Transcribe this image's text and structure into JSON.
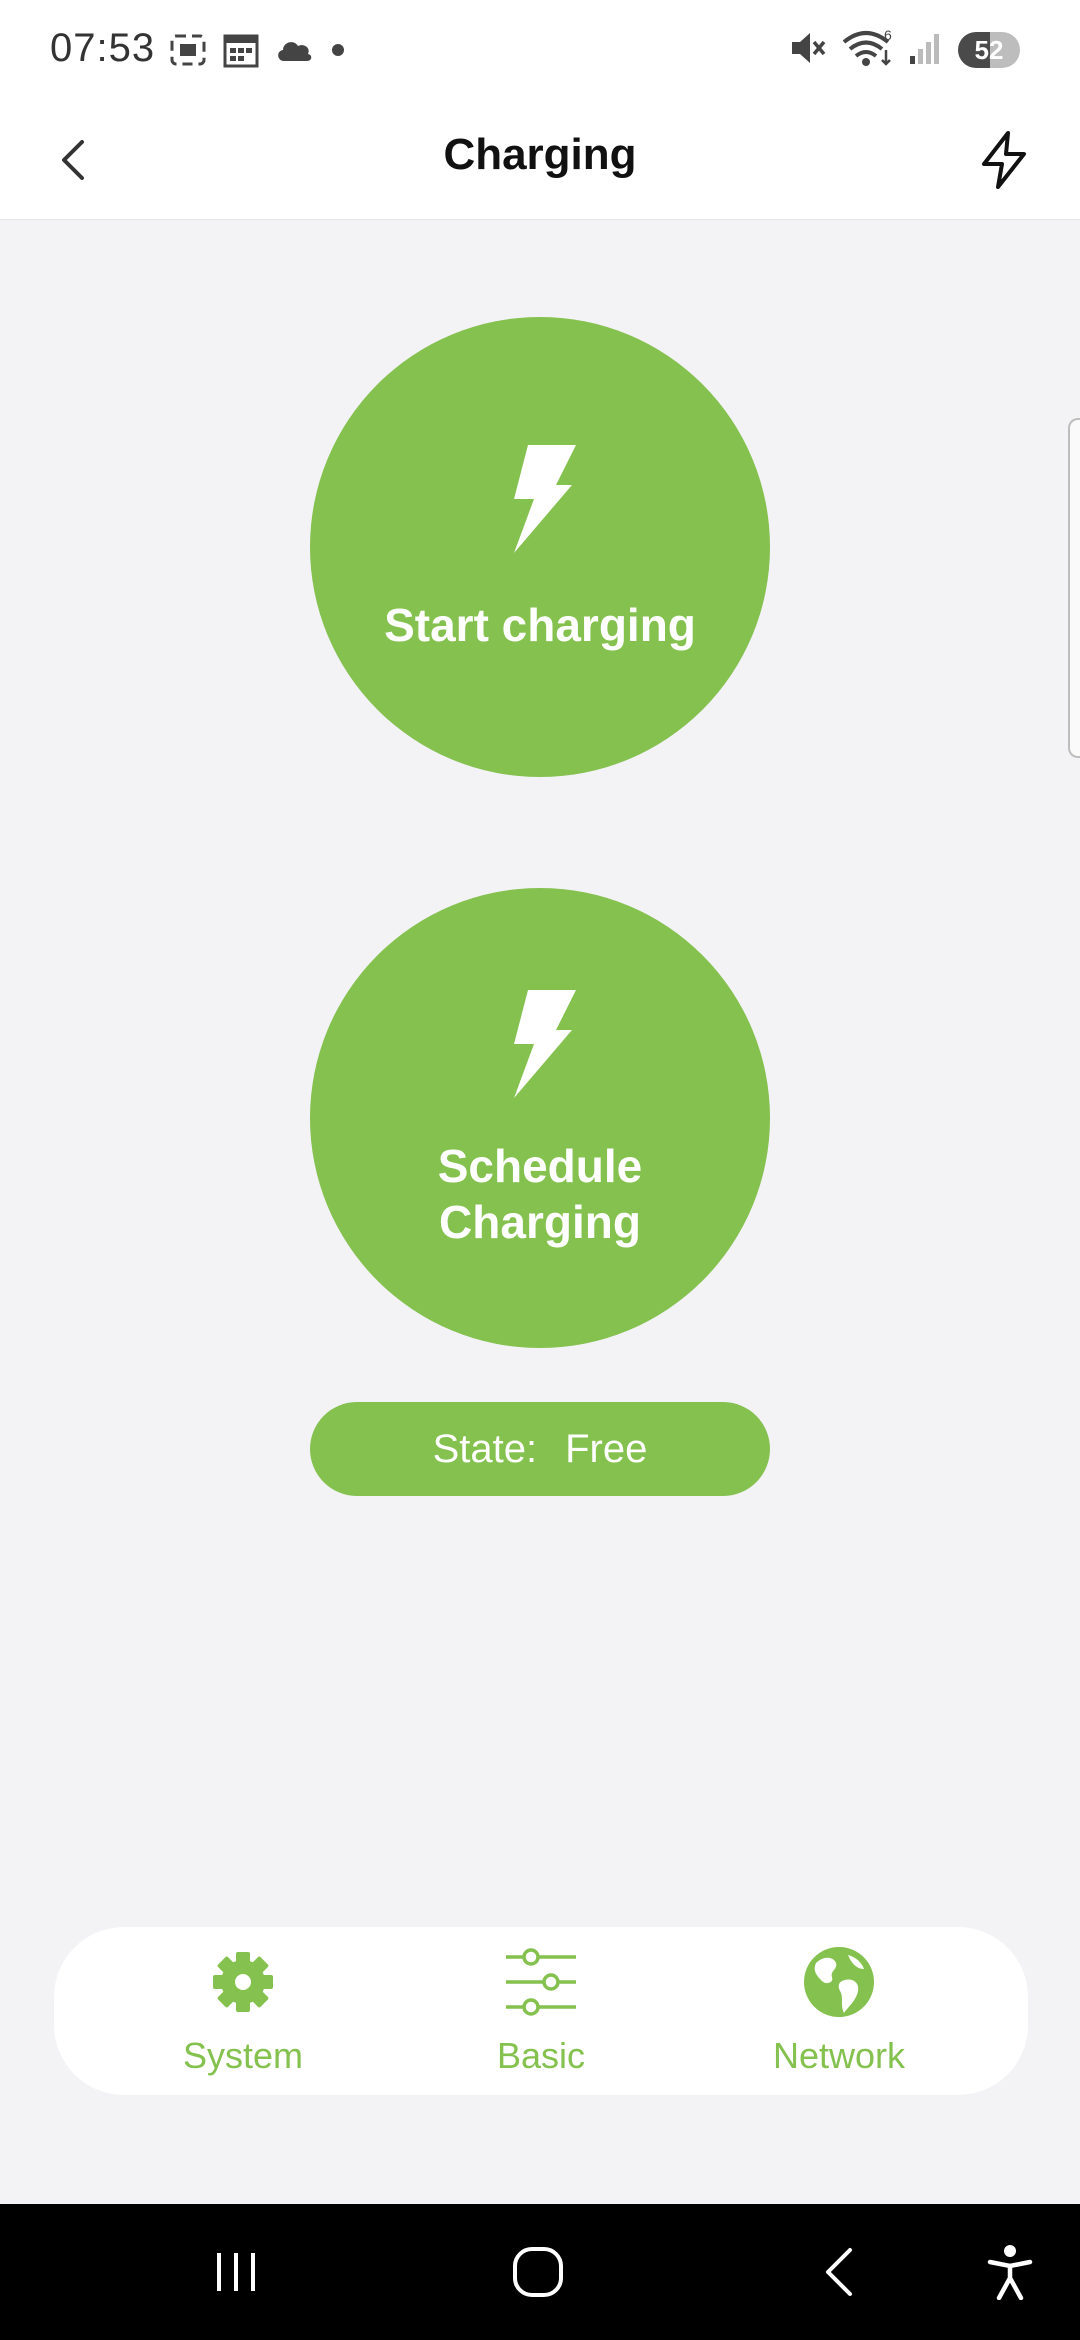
{
  "status_bar": {
    "time": "07:53",
    "battery": "52",
    "icons_left": [
      "screenshot-icon",
      "calendar-icon",
      "cloud-icon",
      "dot-icon"
    ],
    "icons_right": [
      "mute-icon",
      "wifi-icon",
      "signal-icon",
      "battery-icon"
    ]
  },
  "app_bar": {
    "title": "Charging"
  },
  "actions": {
    "start_label": "Start charging",
    "schedule_line1": "Schedule",
    "schedule_line2": "Charging"
  },
  "state": {
    "label": "State:",
    "value": "Free"
  },
  "tabs": [
    {
      "label": "System",
      "icon": "gear-icon"
    },
    {
      "label": "Basic",
      "icon": "sliders-icon"
    },
    {
      "label": "Network",
      "icon": "globe-icon"
    }
  ],
  "colors": {
    "accent": "#84c14e",
    "background": "#f3f2f5"
  }
}
